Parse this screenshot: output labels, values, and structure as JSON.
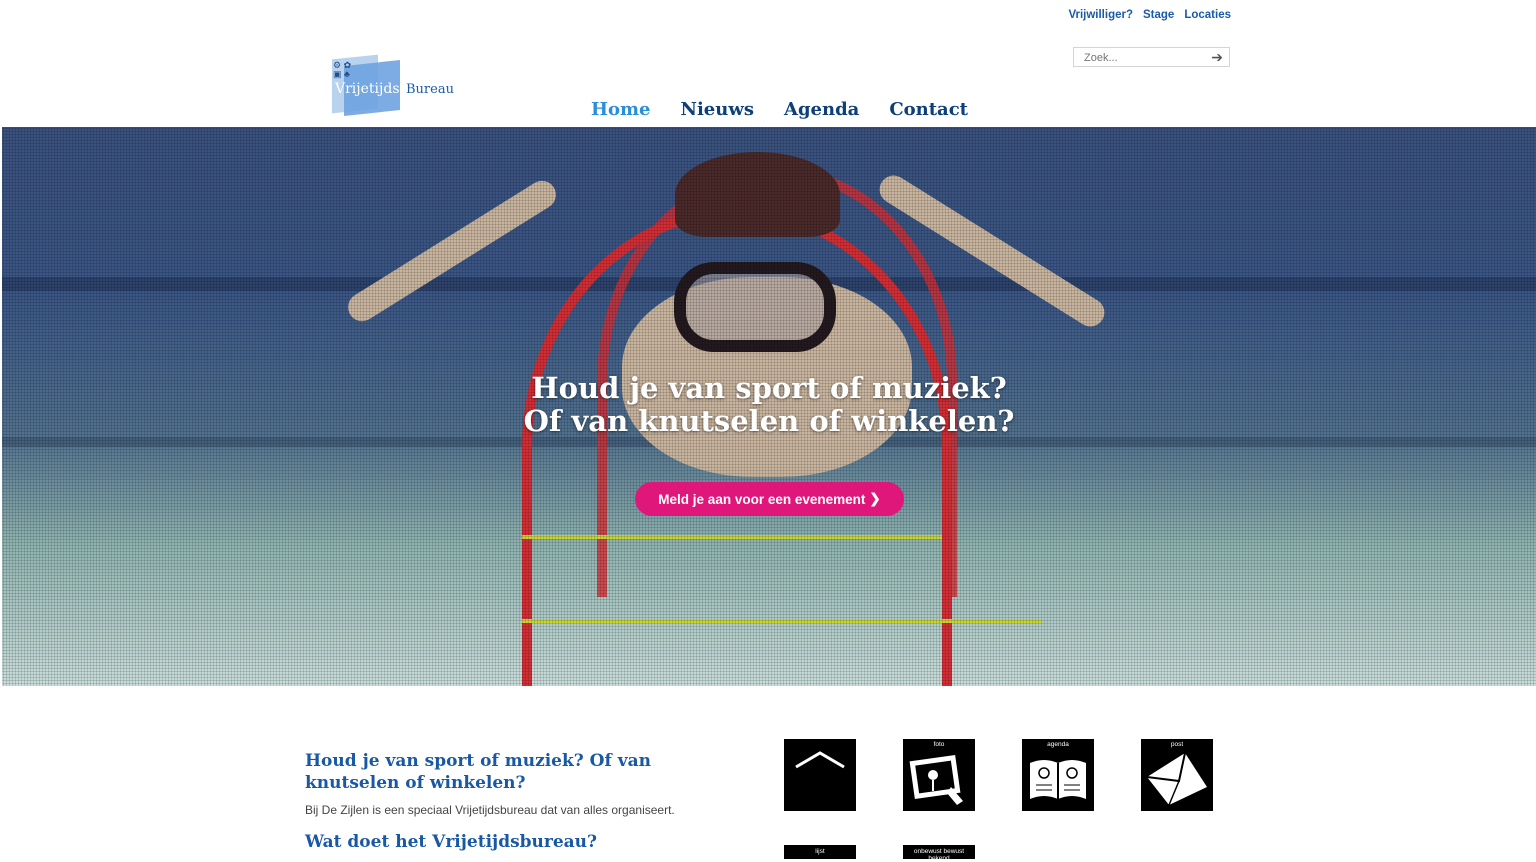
{
  "toplinks": [
    "Vrijwilliger?",
    "Stage",
    "Locaties"
  ],
  "search": {
    "placeholder": "Zoek..."
  },
  "logo": {
    "part1": "Vrijetijds",
    "part2": "Bureau"
  },
  "nav": [
    "Home",
    "Nieuws",
    "Agenda",
    "Contact"
  ],
  "hero": {
    "line1": "Houd je van sport of muziek?",
    "line2": "Of van knutselen of winkelen?",
    "cta": "Meld je aan voor een evenement"
  },
  "intro": {
    "title": "Houd je van sport of muziek? Of van knutselen of winkelen?",
    "text": "Bij De Zijlen is een speciaal Vrijetijdsbureau dat van alles organiseert.",
    "subtitle": "Wat doet het Vrijetijdsbureau?"
  },
  "tiles": {
    "up": "",
    "photo": "foto",
    "agenda": "agenda",
    "mail": "post",
    "list": "lijst",
    "link": "onbewust bewust bekend"
  },
  "icons": {
    "tile_up": "chevron-up-icon",
    "tile_photo": "photo-icon",
    "tile_agenda": "book-icon",
    "tile_mail": "envelope-icon",
    "search": "arrow-right-icon"
  },
  "colors": {
    "brand_blue": "#1858a5",
    "cta_pink": "#e0177a",
    "nav_active": "#2a8fd8"
  }
}
